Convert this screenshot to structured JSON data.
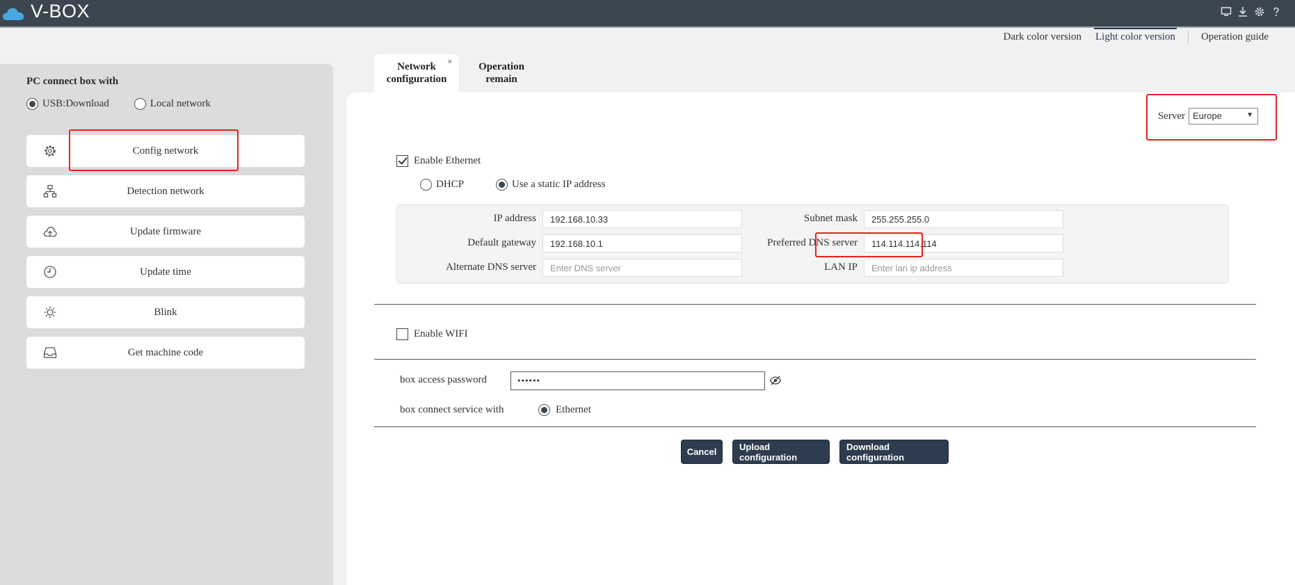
{
  "app": {
    "title": "V-BOX"
  },
  "top_icons": [
    "monitor-icon",
    "download-icon",
    "gear-icon",
    "help-icon"
  ],
  "version_links": {
    "dark": "Dark color version",
    "light": "Light color version",
    "guide": "Operation guide"
  },
  "sidebar": {
    "title": "PC connect box with",
    "connection_options": [
      {
        "label": "USB:Download",
        "selected": true
      },
      {
        "label": "Local network",
        "selected": false
      }
    ],
    "menu": [
      {
        "label": "Config network",
        "icon": "gear-icon"
      },
      {
        "label": "Detection network",
        "icon": "network-tree-icon"
      },
      {
        "label": "Update firmware",
        "icon": "cloud-upload-icon"
      },
      {
        "label": "Update time",
        "icon": "clock-icon"
      },
      {
        "label": "Blink",
        "icon": "sun-icon"
      },
      {
        "label": "Get machine code",
        "icon": "inbox-icon"
      }
    ]
  },
  "tabs": [
    {
      "label_line1": "Network",
      "label_line2": "configuration",
      "active": true,
      "close": "×"
    },
    {
      "label_line1": "Operation",
      "label_line2": "remain",
      "active": false
    }
  ],
  "form": {
    "server": {
      "label": "Server",
      "value": "Europe",
      "arrow": "▼"
    },
    "ethernet": {
      "enable_label": "Enable Ethernet",
      "enabled": true,
      "dhcp_label": "DHCP",
      "static_label": "Use a static IP address",
      "mode": "static"
    },
    "ip_fields": {
      "ip_address": {
        "label": "IP address",
        "value": "192.168.10.33"
      },
      "subnet_mask": {
        "label": "Subnet mask",
        "value": "255.255.255.0"
      },
      "default_gateway": {
        "label": "Default gateway",
        "value": "192.168.10.1"
      },
      "preferred_dns": {
        "label": "Preferred DNS server",
        "value": "114.114.114.114"
      },
      "alternate_dns": {
        "label": "Alternate DNS server",
        "placeholder": "Enter DNS server"
      },
      "lan_ip": {
        "label": "LAN IP",
        "placeholder": "Enter lan ip address"
      }
    },
    "wifi": {
      "enable_label": "Enable WIFI",
      "enabled": false
    },
    "password": {
      "label": "box access password",
      "value": "••••••"
    },
    "service": {
      "label": "box connect service with",
      "option": "Ethernet"
    },
    "buttons": {
      "cancel": "Cancel",
      "upload": "Upload configuration",
      "download": "Download configuration"
    }
  },
  "colors": {
    "topbar": "#3b4650",
    "button": "#2d3c4e",
    "highlight": "#e8211d",
    "cloud": "#4aa8e0"
  }
}
